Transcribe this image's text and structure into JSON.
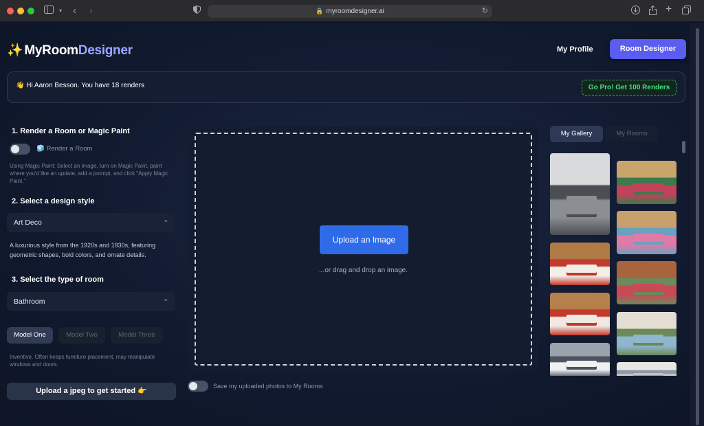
{
  "browser": {
    "url": "myroomdesigner.ai"
  },
  "header": {
    "logo_part1": "MyRoom",
    "logo_part2": "Designer",
    "nav_profile": "My Profile",
    "nav_designer": "Room Designer"
  },
  "banner": {
    "greeting": "👋 Hi Aaron Besson. You have 18 renders",
    "pro_button": "Go Pro! Get 100 Renders"
  },
  "sidebar": {
    "step1_title": "1. Render a Room or Magic Paint",
    "toggle_label": "🧊 Render a Room",
    "magic_paint_help": "Using Magic Paint: Select an image, turn on Magic Paint, paint where you'd like an update, add a prompt, and click \"Apply Magic Paint.\"",
    "step2_title": "2. Select a design style",
    "design_style_value": "Art Deco",
    "design_style_description": "A luxurious style from the 1920s and 1930s, featuring geometric shapes, bold colors, and ornate details.",
    "step3_title": "3. Select the type of room",
    "room_type_value": "Bathroom",
    "models": [
      "Model One",
      "Model Two",
      "Model Three"
    ],
    "model_description": "Inventive. Often keeps furniture placement, may manipulate windows and doors.",
    "upload_button": "Upload a jpeg to get started 👉"
  },
  "main": {
    "upload_button": "Upload an Image",
    "drag_hint": "...or drag and drop an image.",
    "save_toggle_label": "Save my uploaded photos to My Rooms"
  },
  "gallery": {
    "tabs": [
      "My Gallery",
      "My Rooms"
    ],
    "items": [
      {
        "name": "gallery-bathroom-render",
        "palette": [
          "#d9dadc",
          "#8b8e93",
          "#4a4e54"
        ]
      },
      {
        "name": "gallery-colorful-bedroom-1",
        "palette": [
          "#c9a46b",
          "#c2415b",
          "#3c7a4a"
        ]
      },
      {
        "name": "gallery-colorful-bedroom-2",
        "palette": [
          "#c8a06c",
          "#e07ba8",
          "#6aa0c0"
        ]
      },
      {
        "name": "gallery-wood-bedroom-1",
        "palette": [
          "#b07a45",
          "#f2efe9",
          "#c23a2e"
        ]
      },
      {
        "name": "gallery-red-bedroom",
        "palette": [
          "#a8643c",
          "#c74a55",
          "#6c8a5a"
        ]
      },
      {
        "name": "gallery-wood-bedroom-2",
        "palette": [
          "#b5804a",
          "#eeeae3",
          "#c23a2e"
        ]
      },
      {
        "name": "gallery-light-bedroom",
        "palette": [
          "#e3ddd2",
          "#8fb6cf",
          "#6b8a57"
        ]
      },
      {
        "name": "gallery-window-room",
        "palette": [
          "#9aa2ad",
          "#eef0f2",
          "#4b5360"
        ]
      },
      {
        "name": "gallery-bright-room",
        "palette": [
          "#e8e7e3",
          "#c8c4bc",
          "#8a9aa8"
        ]
      }
    ]
  },
  "colors": {
    "accent": "#5b5cf0",
    "upload_blue": "#2f6be8",
    "pro_green": "#4ade80"
  }
}
